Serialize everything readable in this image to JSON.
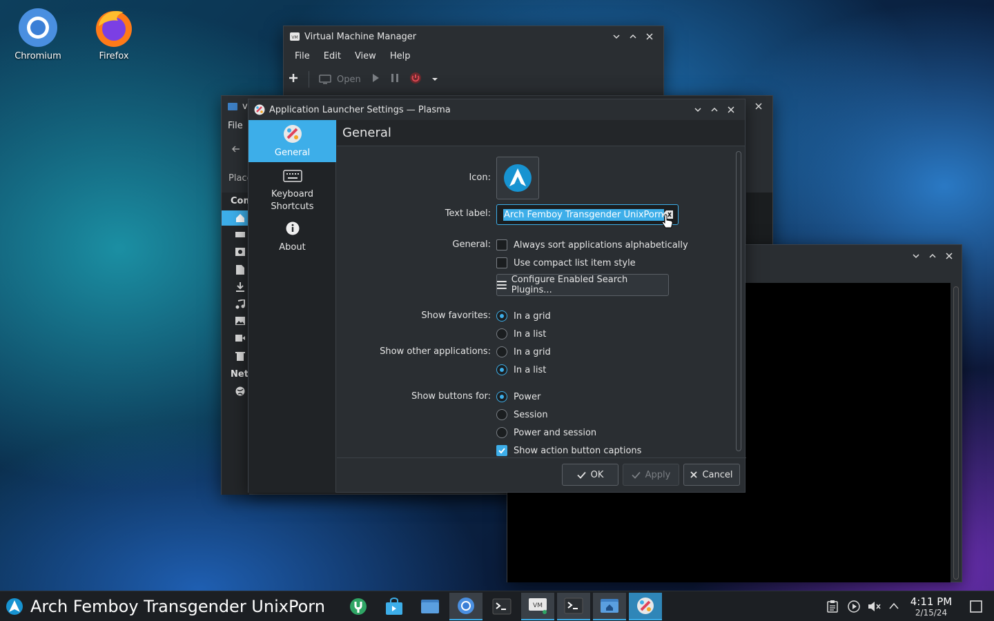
{
  "desktop": {
    "icons": [
      {
        "label": "Chromium"
      },
      {
        "label": "Firefox"
      }
    ]
  },
  "vmm": {
    "title": "Virtual Machine Manager",
    "menu": [
      "File",
      "Edit",
      "View",
      "Help"
    ],
    "toolbar": {
      "open_label": "Open"
    }
  },
  "file_manager": {
    "title_fragment": "vi",
    "menu_file": "File",
    "places_label": "Place",
    "computer_label": "Com",
    "network_label": "Net"
  },
  "launcher_settings": {
    "title": "Application Launcher Settings — Plasma",
    "sidebar": [
      {
        "label": "General"
      },
      {
        "label": "Keyboard Shortcuts"
      },
      {
        "label": "About"
      }
    ],
    "header": "General",
    "icon_label": "Icon:",
    "text_label_label": "Text label:",
    "text_label_value": "Arch Femboy Transgender UnixPorn",
    "general_label": "General:",
    "chk_sort": "Always sort applications alphabetically",
    "chk_compact": "Use compact list item style",
    "configure_plugins": "Configure Enabled Search Plugins...",
    "show_favorites_label": "Show favorites:",
    "fav_grid": "In a grid",
    "fav_list": "In a list",
    "show_other_label": "Show other applications:",
    "other_grid": "In a grid",
    "other_list": "In a list",
    "show_buttons_label": "Show buttons for:",
    "btn_power": "Power",
    "btn_session": "Session",
    "btn_power_session": "Power and session",
    "chk_captions": "Show action button captions",
    "ok": "OK",
    "apply": "Apply",
    "cancel": "Cancel"
  },
  "taskbar": {
    "launcher_label": "Arch Femboy Transgender UnixPorn",
    "time": "4:11 PM",
    "date": "2/15/24"
  },
  "colors": {
    "accent": "#3daee9",
    "window_bg": "#2a2e32",
    "taskbar_bg": "#1c1f23"
  }
}
